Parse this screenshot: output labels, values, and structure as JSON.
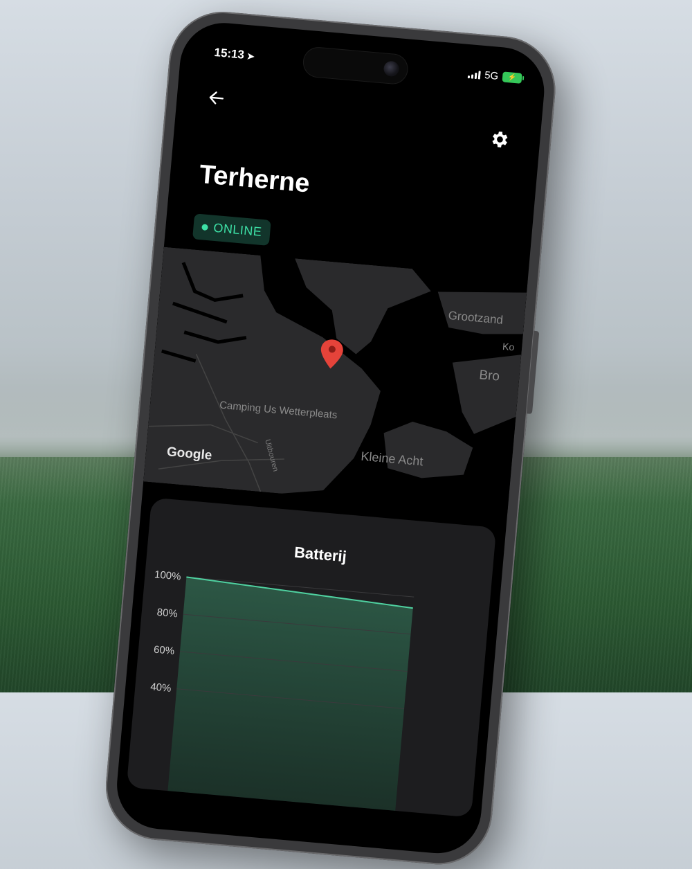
{
  "status_bar": {
    "time": "15:13",
    "network": "5G"
  },
  "header": {
    "back_icon": "arrow-left-icon",
    "settings_icon": "gear-icon"
  },
  "page": {
    "title": "Terherne",
    "status_badge": "ONLINE",
    "status_color": "#3de0a6"
  },
  "map": {
    "labels": {
      "grootzand": "Grootzand",
      "ko": "Ko",
      "bro": "Bro",
      "camping": "Camping Us Wetterpleats",
      "uitbouren": "Uitbouren",
      "kleine_acht": "Kleine Acht"
    },
    "attribution": "Google",
    "marker_icon": "map-pin-icon",
    "marker_color": "#e5433a"
  },
  "battery_card": {
    "title": "Batterij",
    "accent_color": "#2d5a47"
  },
  "chart_data": {
    "type": "area",
    "title": "Batterij",
    "y_ticks": [
      "100%",
      "80%",
      "60%",
      "40%"
    ],
    "ylim": [
      40,
      100
    ],
    "series": [
      {
        "x": [
          0,
          1
        ],
        "y": [
          100,
          94
        ]
      }
    ],
    "grid": true
  }
}
